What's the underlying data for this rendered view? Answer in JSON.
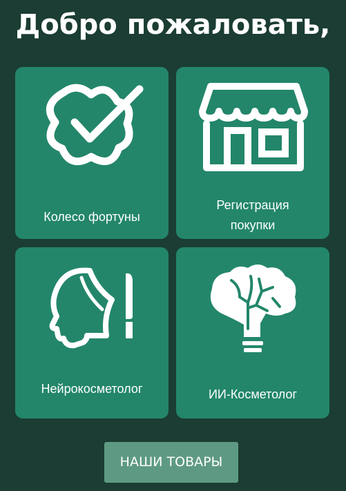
{
  "header": {
    "title": "Добро пожаловать,"
  },
  "tiles": [
    {
      "label": "Колесо фортуны",
      "icon": "badge-check-icon"
    },
    {
      "label": "Регистрация\nпокупки",
      "icon": "shop-icon"
    },
    {
      "label": "Нейрокосметолог",
      "icon": "face-scalpel-icon"
    },
    {
      "label": "ИИ-Косметолог",
      "icon": "brain-bulb-icon"
    }
  ],
  "products_button": {
    "label": "НАШИ ТОВАРЫ"
  },
  "colors": {
    "background": "#1b3d33",
    "tile": "#23866a",
    "button": "#5e9a83",
    "text": "#ffffff"
  }
}
